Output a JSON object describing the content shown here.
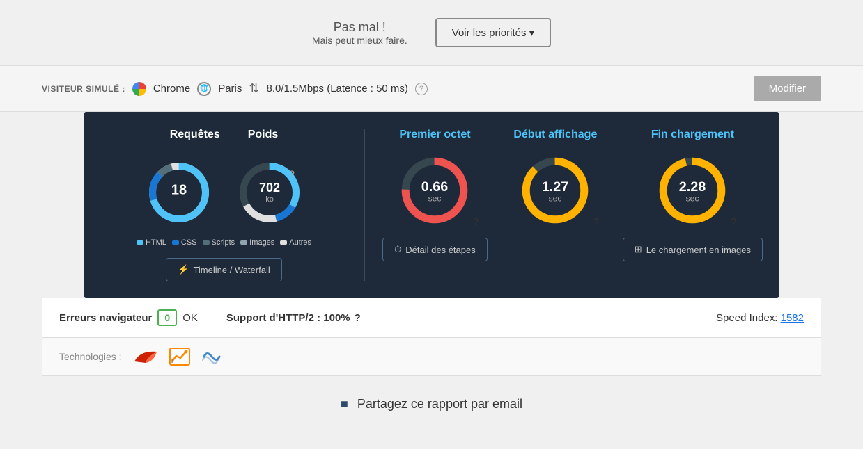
{
  "top": {
    "pas_mal": "Pas mal !",
    "mais": "Mais peut mieux faire.",
    "voir_btn": "Voir les priorités ▾"
  },
  "visitor_bar": {
    "label": "VISITEUR SIMULÉ :",
    "browser": "Chrome",
    "location": "Paris",
    "speed": "8.0/1.5Mbps (Latence : 50 ms)",
    "modifier_btn": "Modifier"
  },
  "metrics": {
    "requetes": {
      "title": "Requêtes",
      "value": "18"
    },
    "poids": {
      "title": "Poids",
      "value": "702",
      "unit": "ko"
    },
    "premier_octet": {
      "title": "Premier octet",
      "value": "0.66",
      "unit": "sec"
    },
    "debut_affichage": {
      "title": "Début affichage",
      "value": "1.27",
      "unit": "sec"
    },
    "fin_chargement": {
      "title": "Fin chargement",
      "value": "2.28",
      "unit": "sec"
    }
  },
  "legend": {
    "items": [
      {
        "label": "HTML",
        "color": "#4fc3f7"
      },
      {
        "label": "CSS",
        "color": "#1976d2"
      },
      {
        "label": "Scripts",
        "color": "#546e7a"
      },
      {
        "label": "Images",
        "color": "#90a4ae"
      },
      {
        "label": "Autres",
        "color": "#e0e0e0"
      }
    ]
  },
  "buttons": {
    "timeline": "Timeline / Waterfall",
    "detail": "Détail des étapes",
    "chargement": "Le chargement en images"
  },
  "bottom": {
    "erreurs_label": "Erreurs navigateur",
    "erreurs_count": "0",
    "erreurs_ok": "OK",
    "http2_label": "Support d'HTTP/2 : 100%",
    "speed_index_label": "Speed Index:",
    "speed_index_value": "1582"
  },
  "tech": {
    "label": "Technologies :"
  },
  "partagez": "Partagez ce rapport par email"
}
